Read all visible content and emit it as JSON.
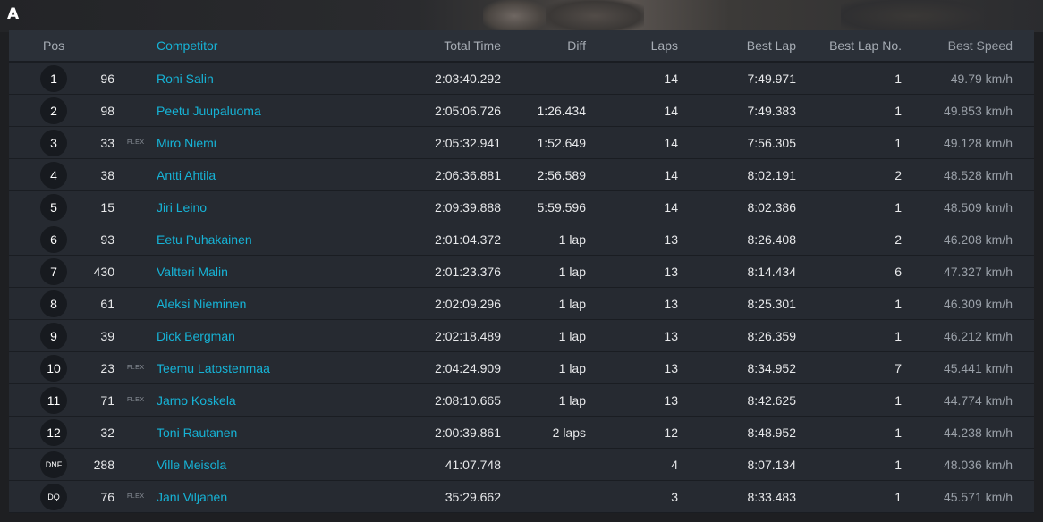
{
  "class_label": "A",
  "headers": {
    "pos": "Pos",
    "competitor": "Competitor",
    "total_time": "Total Time",
    "diff": "Diff",
    "laps": "Laps",
    "best_lap": "Best Lap",
    "best_lap_no": "Best Lap No.",
    "best_speed": "Best Speed"
  },
  "rows": [
    {
      "pos": "1",
      "num": "96",
      "flex": "",
      "name": "Roni Salin",
      "total": "2:03:40.292",
      "diff": "",
      "laps": "14",
      "best": "7:49.971",
      "bln": "1",
      "speed": "49.79 km/h"
    },
    {
      "pos": "2",
      "num": "98",
      "flex": "",
      "name": "Peetu Juupaluoma",
      "total": "2:05:06.726",
      "diff": "1:26.434",
      "laps": "14",
      "best": "7:49.383",
      "bln": "1",
      "speed": "49.853 km/h"
    },
    {
      "pos": "3",
      "num": "33",
      "flex": "FLEX",
      "name": "Miro Niemi",
      "total": "2:05:32.941",
      "diff": "1:52.649",
      "laps": "14",
      "best": "7:56.305",
      "bln": "1",
      "speed": "49.128 km/h"
    },
    {
      "pos": "4",
      "num": "38",
      "flex": "",
      "name": "Antti Ahtila",
      "total": "2:06:36.881",
      "diff": "2:56.589",
      "laps": "14",
      "best": "8:02.191",
      "bln": "2",
      "speed": "48.528 km/h"
    },
    {
      "pos": "5",
      "num": "15",
      "flex": "",
      "name": "Jiri Leino",
      "total": "2:09:39.888",
      "diff": "5:59.596",
      "laps": "14",
      "best": "8:02.386",
      "bln": "1",
      "speed": "48.509 km/h"
    },
    {
      "pos": "6",
      "num": "93",
      "flex": "",
      "name": "Eetu Puhakainen",
      "total": "2:01:04.372",
      "diff": "1 lap",
      "laps": "13",
      "best": "8:26.408",
      "bln": "2",
      "speed": "46.208 km/h"
    },
    {
      "pos": "7",
      "num": "430",
      "flex": "",
      "name": "Valtteri Malin",
      "total": "2:01:23.376",
      "diff": "1 lap",
      "laps": "13",
      "best": "8:14.434",
      "bln": "6",
      "speed": "47.327 km/h"
    },
    {
      "pos": "8",
      "num": "61",
      "flex": "",
      "name": "Aleksi Nieminen",
      "total": "2:02:09.296",
      "diff": "1 lap",
      "laps": "13",
      "best": "8:25.301",
      "bln": "1",
      "speed": "46.309 km/h"
    },
    {
      "pos": "9",
      "num": "39",
      "flex": "",
      "name": "Dick Bergman",
      "total": "2:02:18.489",
      "diff": "1 lap",
      "laps": "13",
      "best": "8:26.359",
      "bln": "1",
      "speed": "46.212 km/h"
    },
    {
      "pos": "10",
      "num": "23",
      "flex": "FLEX",
      "name": "Teemu Latostenmaa",
      "total": "2:04:24.909",
      "diff": "1 lap",
      "laps": "13",
      "best": "8:34.952",
      "bln": "7",
      "speed": "45.441 km/h"
    },
    {
      "pos": "11",
      "num": "71",
      "flex": "FLEX",
      "name": "Jarno Koskela",
      "total": "2:08:10.665",
      "diff": "1 lap",
      "laps": "13",
      "best": "8:42.625",
      "bln": "1",
      "speed": "44.774 km/h"
    },
    {
      "pos": "12",
      "num": "32",
      "flex": "",
      "name": "Toni Rautanen",
      "total": "2:00:39.861",
      "diff": "2 laps",
      "laps": "12",
      "best": "8:48.952",
      "bln": "1",
      "speed": "44.238 km/h"
    },
    {
      "pos": "DNF",
      "num": "288",
      "flex": "",
      "name": "Ville Meisola",
      "total": "41:07.748",
      "diff": "",
      "laps": "4",
      "best": "8:07.134",
      "bln": "1",
      "speed": "48.036 km/h"
    },
    {
      "pos": "DQ",
      "num": "76",
      "flex": "FLEX",
      "name": "Jani Viljanen",
      "total": "35:29.662",
      "diff": "",
      "laps": "3",
      "best": "8:33.483",
      "bln": "1",
      "speed": "45.571 km/h"
    }
  ]
}
